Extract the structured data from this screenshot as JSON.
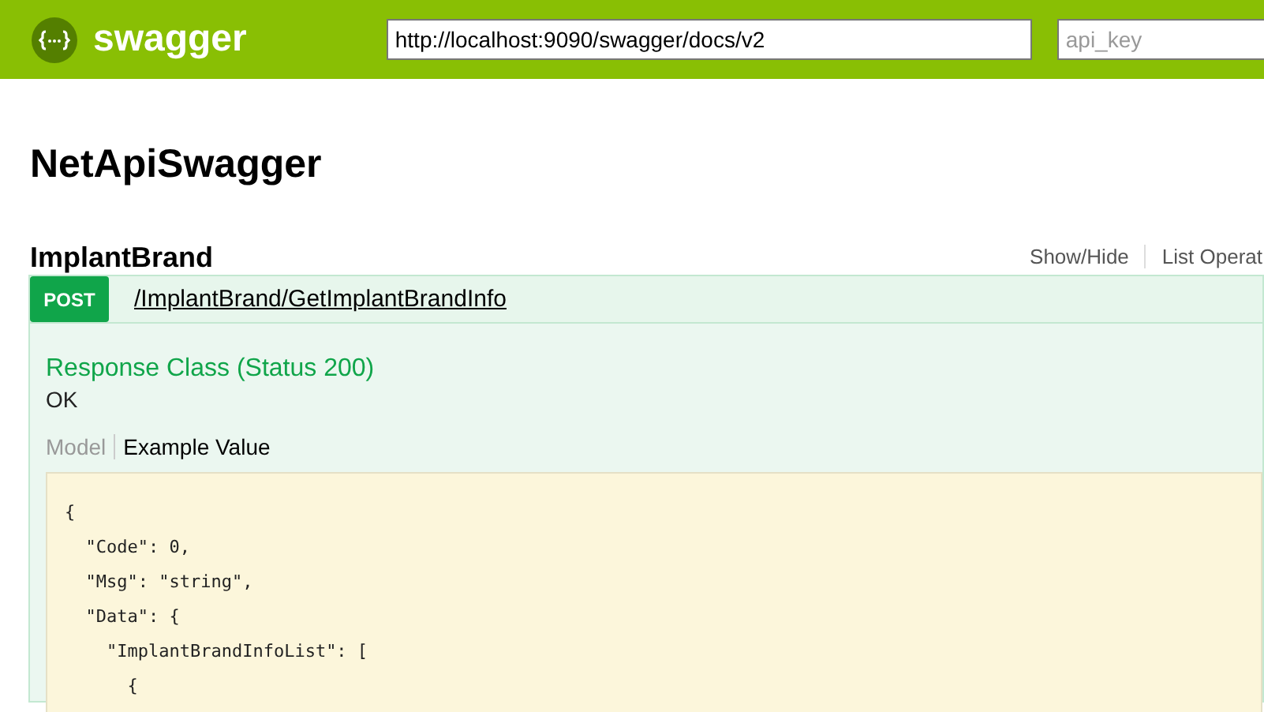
{
  "header": {
    "logo_text": "swagger",
    "url_field": {
      "value": "http://localhost:9090/swagger/docs/v2"
    },
    "api_key_field": {
      "placeholder": "api_key"
    }
  },
  "title": "NetApiSwagger",
  "resource": {
    "name": "ImplantBrand",
    "links": [
      "Show/Hide",
      "List Operat"
    ],
    "operation": {
      "method": "POST",
      "path": "/ImplantBrand/GetImplantBrandInfo",
      "response_heading": "Response Class (Status 200)",
      "response_text": "OK",
      "tabs": [
        {
          "label": "Model",
          "selected": false
        },
        {
          "label": "Example Value",
          "selected": true
        }
      ],
      "code_lines": [
        "{",
        "  \"Code\": 0,",
        "  \"Msg\": \"string\",",
        "  \"Data\": {",
        "    \"ImplantBrandInfoList\": [",
        "      {"
      ]
    }
  }
}
